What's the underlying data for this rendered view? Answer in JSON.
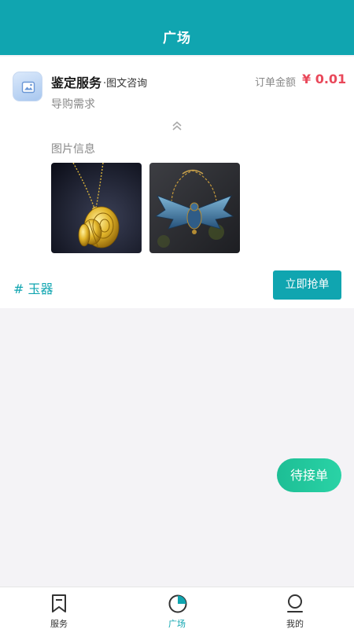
{
  "header": {
    "title": "广场"
  },
  "order": {
    "service_title": "鉴定服务",
    "service_sub": "·图文咨询",
    "amount_label": "订单金额",
    "amount": "¥ 0.01",
    "requirement": "导购需求",
    "images_label": "图片信息",
    "images": [
      "gold-peacock-pendant",
      "blue-winged-scarab-necklace"
    ],
    "tag": "# 玉器",
    "grab_label": "立即抢单"
  },
  "fab": {
    "label": "待接单"
  },
  "tabbar": {
    "items": [
      {
        "label": "服务",
        "icon": "bookmark-icon",
        "active": false
      },
      {
        "label": "广场",
        "icon": "pie-chart-icon",
        "active": true
      },
      {
        "label": "我的",
        "icon": "user-icon",
        "active": false
      }
    ]
  },
  "colors": {
    "accent": "#10a5b0",
    "price": "#e9485a",
    "fab": "#22c79c"
  }
}
